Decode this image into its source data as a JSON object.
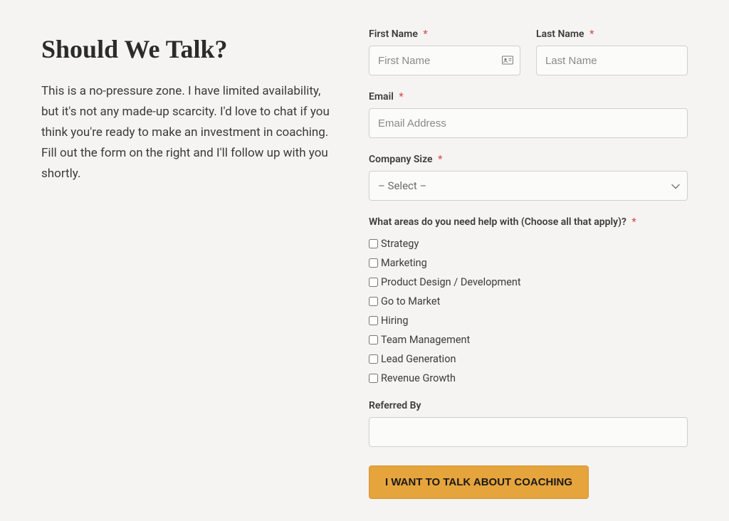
{
  "heading": "Should We Talk?",
  "intro": "This is a no-pressure zone. I have limited availability, but it's not any made-up scarcity. I'd love to chat if you think you're ready to make an investment in coaching. Fill out the form on the right and I'll follow up with you shortly.",
  "form": {
    "first_name": {
      "label": "First Name",
      "placeholder": "First Name",
      "required": true
    },
    "last_name": {
      "label": "Last Name",
      "placeholder": "Last Name",
      "required": true
    },
    "email": {
      "label": "Email",
      "placeholder": "Email Address",
      "required": true
    },
    "company_size": {
      "label": "Company Size",
      "selected": "– Select –",
      "required": true
    },
    "areas": {
      "label": "What areas do you need help with (Choose all that apply)?",
      "required": true,
      "options": [
        "Strategy",
        "Marketing",
        "Product Design / Development",
        "Go to Market",
        "Hiring",
        "Team Management",
        "Lead Generation",
        "Revenue Growth"
      ]
    },
    "referred_by": {
      "label": "Referred By"
    },
    "submit": "I WANT TO TALK ABOUT COACHING"
  },
  "required_marker": "*"
}
